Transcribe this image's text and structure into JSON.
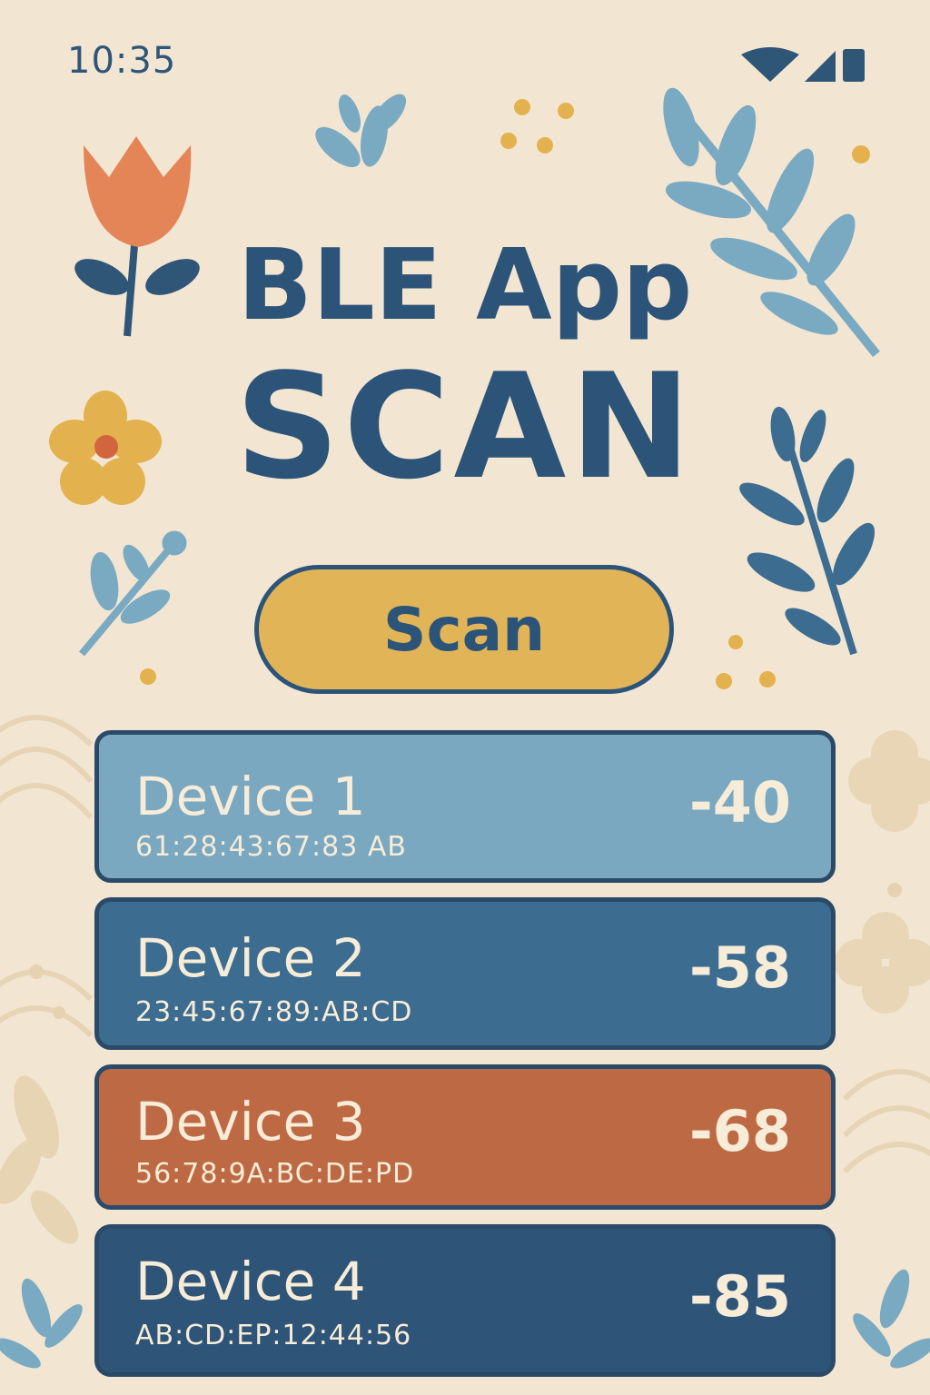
{
  "status_bar": {
    "time": "10:35",
    "icons": [
      "wifi-icon",
      "signal-icon",
      "battery-icon"
    ]
  },
  "header": {
    "title_line1": "BLE App",
    "title_line2": "SCAN"
  },
  "scan_button": {
    "label": "Scan"
  },
  "devices": [
    {
      "name": "Device 1",
      "mac": "61:28:43:67:83 AB",
      "rssi": "-40",
      "color": "#79a8c0"
    },
    {
      "name": "Device 2",
      "mac": "23:45:67:89:AB:CD",
      "rssi": "-58",
      "color": "#3c6d90"
    },
    {
      "name": "Device 3",
      "mac": "56:78:9A:BC:DE:PD",
      "rssi": "-68",
      "color": "#bd6a44"
    },
    {
      "name": "Device 4",
      "mac": "AB:CD:EP:12:44:56",
      "rssi": "-85",
      "color": "#2e5478"
    }
  ],
  "colors": {
    "background": "#f2e6d3",
    "title": "#2c5478",
    "button_fill": "#e1b458",
    "text_light": "#f7ecd8"
  },
  "decorations": [
    "tulip-icon",
    "yellow-flower-icon",
    "leaf-sprig-icon",
    "fern-icon",
    "dot-cluster-icon",
    "wave-pattern-icon",
    "clover-flower-icon"
  ]
}
